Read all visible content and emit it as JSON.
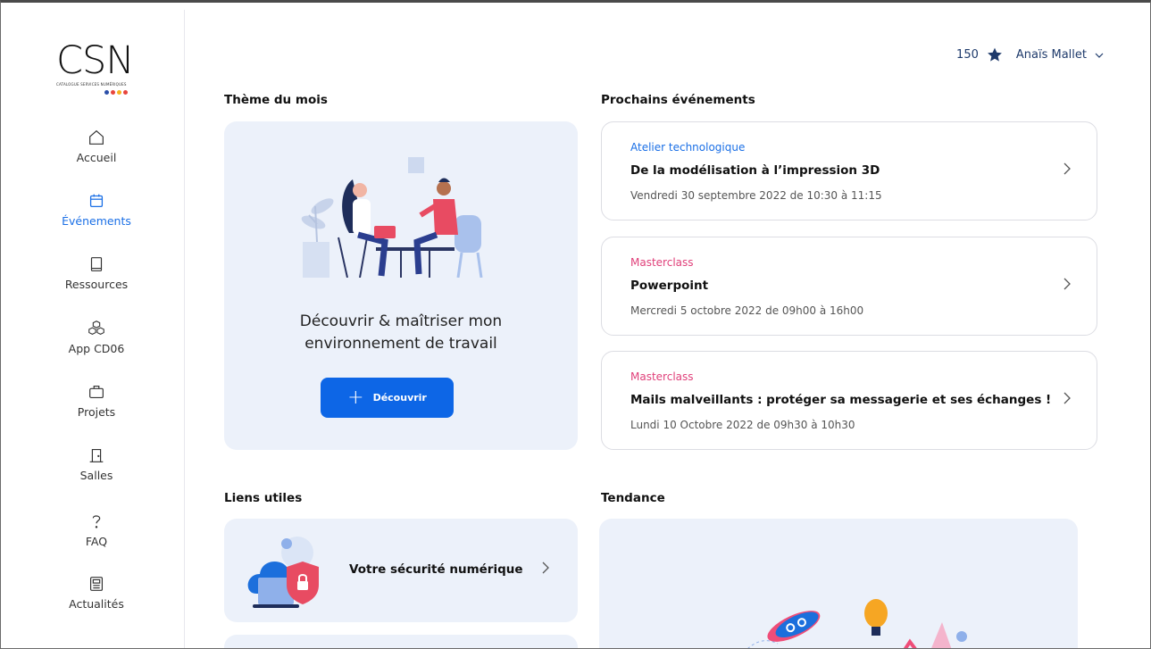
{
  "brand": {
    "logo_text": "CSN",
    "logo_sub": "CATALOGUE SERVICES NUMÉRIQUES",
    "dot_colors": [
      "#2b4fa8",
      "#e8453c",
      "#f6b21b",
      "#e8453c"
    ]
  },
  "sidebar": {
    "items": [
      {
        "label": "Accueil",
        "icon": "home-icon"
      },
      {
        "label": "Événements",
        "icon": "calendar-icon",
        "active": true
      },
      {
        "label": "Ressources",
        "icon": "book-icon"
      },
      {
        "label": "App CD06",
        "icon": "cubes-icon"
      },
      {
        "label": "Projets",
        "icon": "briefcase-icon"
      },
      {
        "label": "Salles",
        "icon": "door-icon"
      },
      {
        "label": "FAQ",
        "icon": "question-icon"
      },
      {
        "label": "Actualités",
        "icon": "newspaper-icon"
      }
    ]
  },
  "header": {
    "points": "150",
    "points_icon": "star-icon",
    "user_name": "Anaïs Mallet"
  },
  "theme": {
    "section_title": "Thème du mois",
    "line1": "Découvrir & maîtriser mon",
    "line2": "environnement de travail",
    "button_label": "Découvrir"
  },
  "events": {
    "section_title": "Prochains événements",
    "items": [
      {
        "category": "Atelier technologique",
        "category_color": "#1a6fe6",
        "title": "De la modélisation à l’impression 3D",
        "date": "Vendredi 30 septembre 2022 de 10:30 à 11:15"
      },
      {
        "category": "Masterclass",
        "category_color": "#e0407a",
        "title": "Powerpoint",
        "date": "Mercredi 5 octobre 2022 de 09h00 à 16h00"
      },
      {
        "category": "Masterclass",
        "category_color": "#e0407a",
        "title": "Mails malveillants : protéger sa messagerie et ses échanges !",
        "date": "Lundi 10 Octobre 2022 de 09h30 à 10h30"
      }
    ]
  },
  "links": {
    "section_title": "Liens utiles",
    "items": [
      {
        "label": "Votre sécurité numérique"
      }
    ]
  },
  "trend": {
    "section_title": "Tendance"
  },
  "colors": {
    "accent": "#0d66e6",
    "card_bg": "#ecf1fa",
    "masterclass": "#e0407a",
    "atelier": "#1a6fe6"
  }
}
